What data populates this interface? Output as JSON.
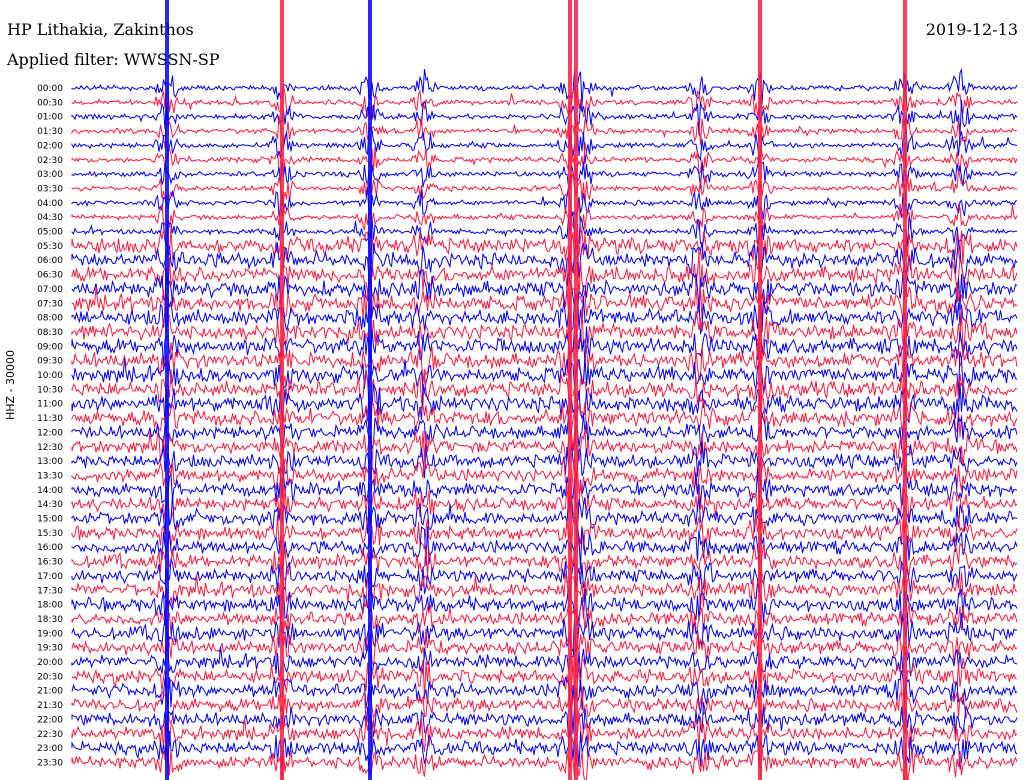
{
  "header": {
    "station": "HP Lithakia, Zakinthos",
    "filter": "Applied filter: WWSSN-SP",
    "date": "2019-12-13"
  },
  "chart_data": {
    "type": "line",
    "ylabel": "HHZ - 30000",
    "colors": {
      "odd": "#0000ff",
      "even": "#ff1a3c"
    },
    "tick_labels": [
      "00:00",
      "00:30",
      "01:00",
      "01:30",
      "02:00",
      "02:30",
      "03:00",
      "03:30",
      "04:00",
      "04:30",
      "05:00",
      "05:30",
      "06:00",
      "06:30",
      "07:00",
      "07:30",
      "08:00",
      "08:30",
      "09:00",
      "09:30",
      "10:00",
      "10:30",
      "11:00",
      "11:30",
      "12:00",
      "12:30",
      "13:00",
      "13:30",
      "14:00",
      "14:30",
      "15:00",
      "15:30",
      "16:00",
      "16:30",
      "17:00",
      "17:30",
      "18:00",
      "18:30",
      "19:00",
      "19:30",
      "20:00",
      "20:30",
      "21:00",
      "21:30",
      "22:00",
      "22:30",
      "23:00",
      "23:30"
    ]
  }
}
